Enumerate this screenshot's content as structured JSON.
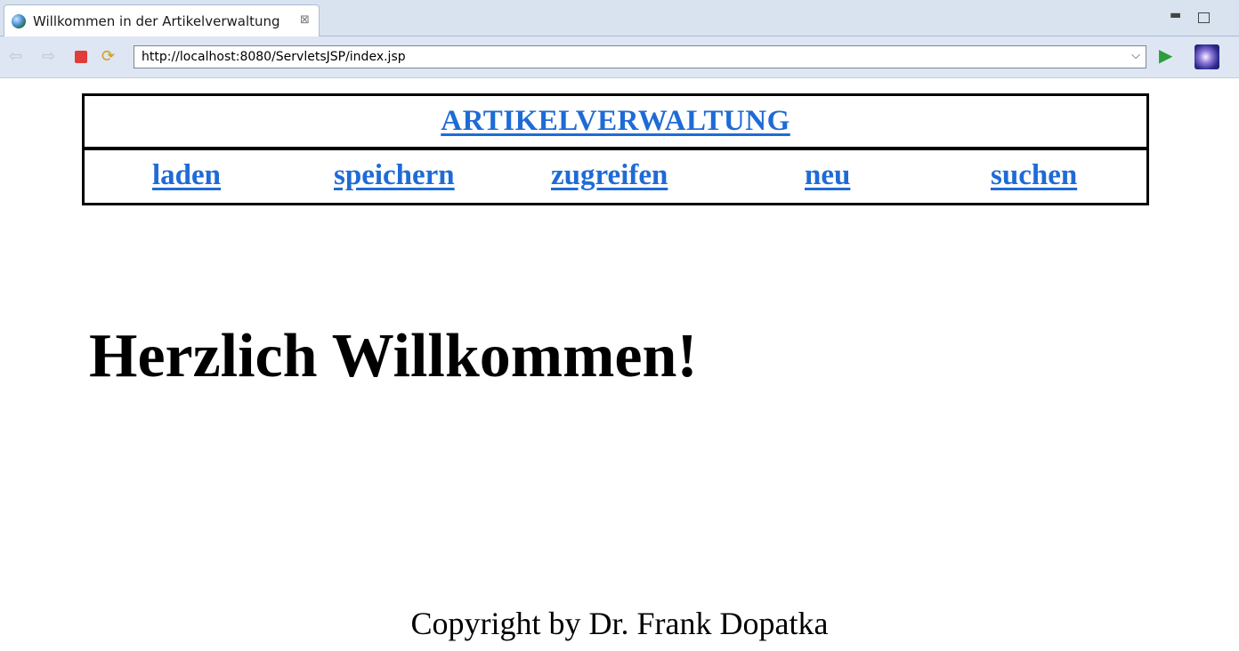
{
  "browser": {
    "tab_title": "Willkommen in der Artikelverwaltung",
    "tab_close": "⊠",
    "minimize": "▭",
    "url": "http://localhost:8080/ServletsJSP/index.jsp",
    "dropdown": "⌵",
    "back": "⇦",
    "forward": "⇨",
    "refresh": "⟳",
    "go": "▶"
  },
  "page": {
    "heading_link": "ARTIKELVERWALTUNG",
    "nav": [
      "laden",
      "speichern",
      "zugreifen",
      "neu",
      "suchen"
    ],
    "welcome": "Herzlich Willkommen!",
    "copyright": "Copyright by Dr. Frank Dopatka"
  },
  "colors": {
    "link": "#1f6bd6",
    "chrome": "#d9e3f0"
  }
}
